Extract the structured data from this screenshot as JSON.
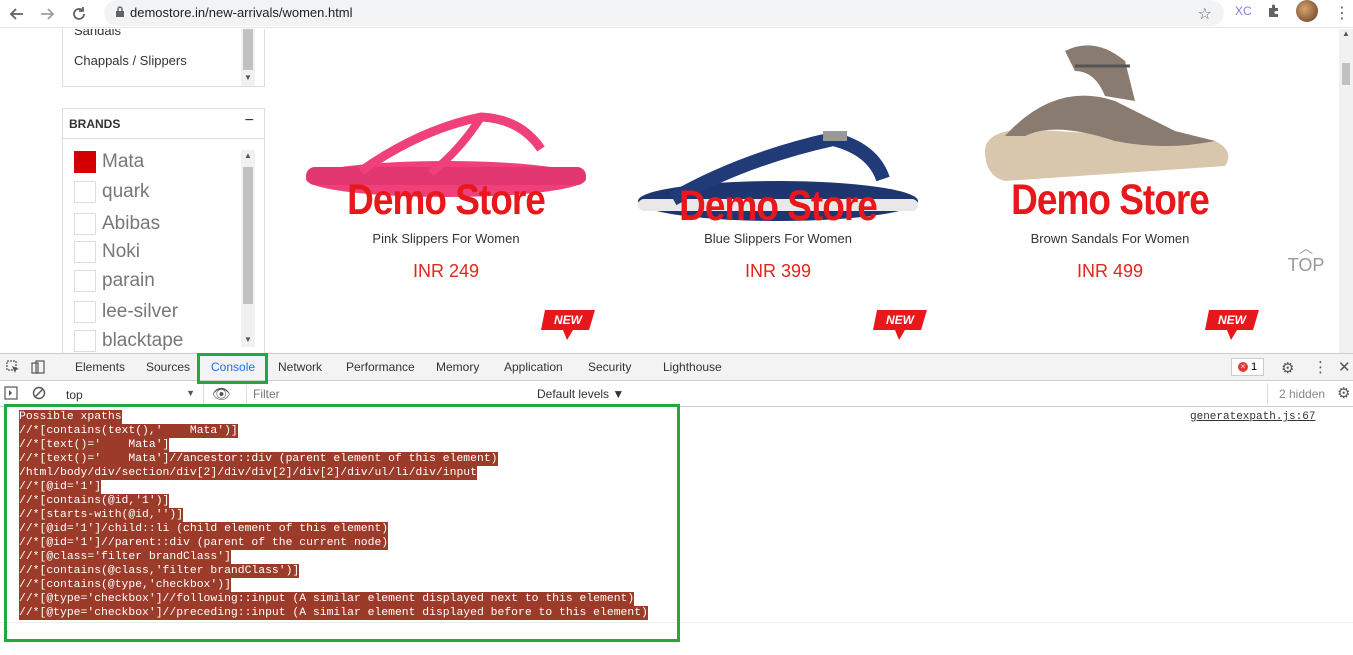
{
  "browser": {
    "url": "demostore.in/new-arrivals/women.html",
    "profile_initials": "XC",
    "icons": [
      "back-icon",
      "forward-icon",
      "reload-icon",
      "lock-icon",
      "star-icon",
      "puzzle-icon",
      "menu-icon"
    ]
  },
  "sidebar": {
    "category_items": [
      "Sandals",
      "Chappals / Slippers"
    ],
    "brands_title": "BRANDS",
    "brands_toggle": "−",
    "brands": [
      {
        "label": "Mata",
        "checked": true
      },
      {
        "label": "quark",
        "checked": false
      },
      {
        "label": "Abibas",
        "checked": false
      },
      {
        "label": "Noki",
        "checked": false
      },
      {
        "label": "parain",
        "checked": false
      },
      {
        "label": "lee-silver",
        "checked": false
      },
      {
        "label": "blacktape",
        "checked": false
      }
    ]
  },
  "products": [
    {
      "brand_text": "Demo Store",
      "name": "Pink Slippers For Women",
      "price": "INR 249",
      "badge": "NEW",
      "color": "#f0407a"
    },
    {
      "brand_text": "Demo Store",
      "name": "Blue Slippers For Women",
      "price": "INR 399",
      "badge": "NEW",
      "color": "#1f3570"
    },
    {
      "brand_text": "Demo Store",
      "name": "Brown Sandals For Women",
      "price": "INR 499",
      "badge": "NEW",
      "color": "#8a7b70"
    }
  ],
  "top_button": {
    "label": "TOP"
  },
  "devtools": {
    "tabs": [
      "Elements",
      "Sources",
      "Console",
      "Network",
      "Performance",
      "Memory",
      "Application",
      "Security",
      "Lighthouse"
    ],
    "active_tab": "Console",
    "error_count": "1",
    "context": "top",
    "filter_placeholder": "Filter",
    "levels": "Default levels ▼",
    "hidden": "2 hidden",
    "source_link": "generatexpath.js:67",
    "prompt": "›",
    "console_lines": [
      "Possible xpaths",
      "//*[contains(text(),'    Mata')]",
      "//*[text()='    Mata']",
      "//*[text()='    Mata']//ancestor::div (parent element of this element)",
      "/html/body/div/section/div[2]/div/div[2]/div[2]/div/ul/li/div/input",
      "//*[@id='1']",
      "//*[contains(@id,'1')]",
      "//*[starts-with(@id,'')]",
      "//*[@id='1']/child::li (child element of this element)",
      "//*[@id='1']//parent::div (parent of the current node)",
      "//*[@class='filter brandClass']",
      "//*[contains(@class,'filter brandClass')]",
      "//*[contains(@type,'checkbox')]",
      "//*[@type='checkbox']//following::input (A similar element displayed next to this element)",
      "//*[@type='checkbox']//preceding::input (A similar element displayed before to this element)"
    ]
  },
  "colors": {
    "accent_red": "#e8171b",
    "highlight_green": "#22a745",
    "console_highlight": "#9c3b2a"
  }
}
